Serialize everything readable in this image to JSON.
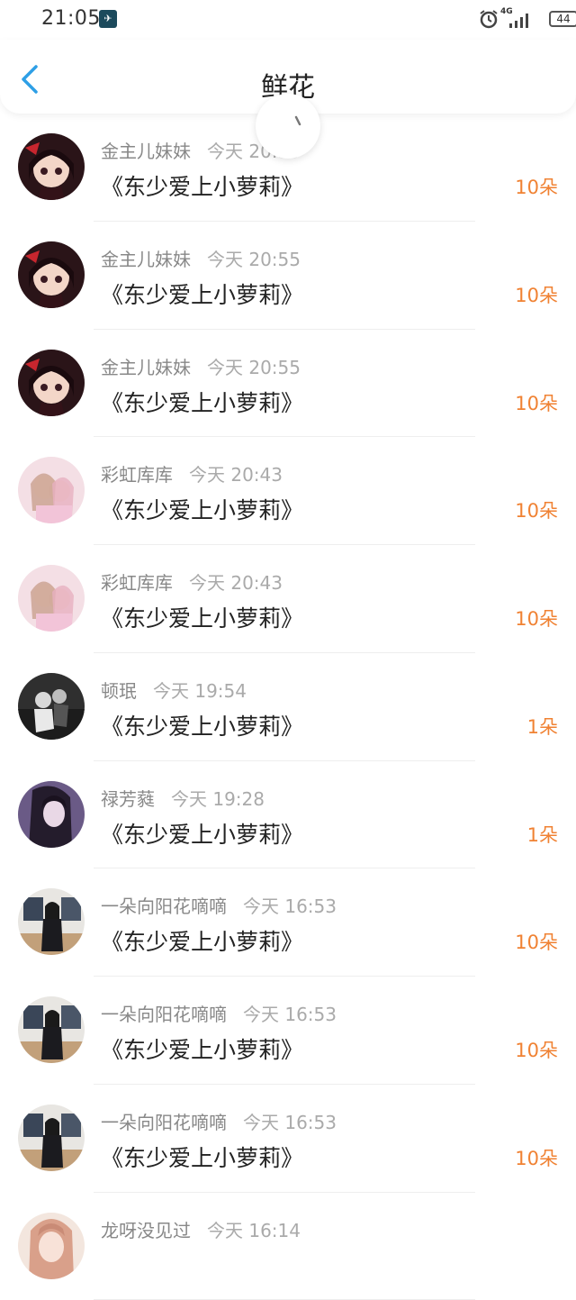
{
  "status_bar": {
    "time": "21:05",
    "network": "4G",
    "battery": "44"
  },
  "header": {
    "title": "鲜花"
  },
  "accent_color": "#2e9fe6",
  "amount_color": "#f08233",
  "rows": [
    {
      "user": "金主儿妹妹",
      "time": "今天 20:55",
      "book": "《东少爱上小萝莉》",
      "amount": "10朵",
      "avatar": "avatar-anime-girl-red"
    },
    {
      "user": "金主儿妹妹",
      "time": "今天 20:55",
      "book": "《东少爱上小萝莉》",
      "amount": "10朵",
      "avatar": "avatar-anime-girl-red"
    },
    {
      "user": "金主儿妹妹",
      "time": "今天 20:55",
      "book": "《东少爱上小萝莉》",
      "amount": "10朵",
      "avatar": "avatar-anime-girl-red"
    },
    {
      "user": "彩虹库库",
      "time": "今天 20:43",
      "book": "《东少爱上小萝莉》",
      "amount": "10朵",
      "avatar": "avatar-pastel-girls"
    },
    {
      "user": "彩虹库库",
      "time": "今天 20:43",
      "book": "《东少爱上小萝莉》",
      "amount": "10朵",
      "avatar": "avatar-pastel-girls"
    },
    {
      "user": "顿珉",
      "time": "今天 19:54",
      "book": "《东少爱上小萝莉》",
      "amount": "1朵",
      "avatar": "avatar-monochrome-couple"
    },
    {
      "user": "禄芳蕤",
      "time": "今天 19:28",
      "book": "《东少爱上小萝莉》",
      "amount": "1朵",
      "avatar": "avatar-purple-girl"
    },
    {
      "user": "一朵向阳花嘀嘀",
      "time": "今天 16:53",
      "book": "《东少爱上小萝莉》",
      "amount": "10朵",
      "avatar": "avatar-classroom-girl"
    },
    {
      "user": "一朵向阳花嘀嘀",
      "time": "今天 16:53",
      "book": "《东少爱上小萝莉》",
      "amount": "10朵",
      "avatar": "avatar-classroom-girl"
    },
    {
      "user": "一朵向阳花嘀嘀",
      "time": "今天 16:53",
      "book": "《东少爱上小萝莉》",
      "amount": "10朵",
      "avatar": "avatar-classroom-girl"
    },
    {
      "user": "龙呀没见过",
      "time": "今天 16:14",
      "book": "",
      "amount": "",
      "avatar": "avatar-pink-hair-girl"
    }
  ]
}
